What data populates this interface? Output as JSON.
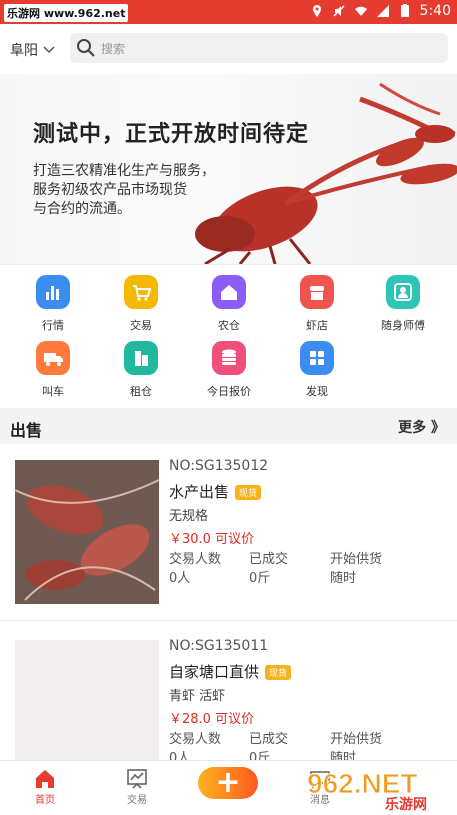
{
  "status": {
    "watermark": "乐游网 www.962.net",
    "time": "5:40"
  },
  "header": {
    "city": "阜阳",
    "search_placeholder": "搜索"
  },
  "banner": {
    "headline": "测试中，正式开放时间待定",
    "sub_lines": [
      "打造三农精准化生产与服务，",
      "服务初级农产品市场现货",
      "与合约的流通。"
    ]
  },
  "categories": [
    {
      "label": "行情",
      "color": "#3b8ef0",
      "icon": "chart-icon"
    },
    {
      "label": "交易",
      "color": "#f5b800",
      "icon": "cart-icon"
    },
    {
      "label": "农仓",
      "color": "#8b5cf6",
      "icon": "home-icon"
    },
    {
      "label": "虾店",
      "color": "#f0544f",
      "icon": "shop-icon"
    },
    {
      "label": "随身师傅",
      "color": "#2ec4b6",
      "icon": "person-icon"
    },
    {
      "label": "叫车",
      "color": "#ff7a3c",
      "icon": "truck-icon"
    },
    {
      "label": "租仓",
      "color": "#22b8a0",
      "icon": "warehouse-icon"
    },
    {
      "label": "今日报价",
      "color": "#f04f7a",
      "icon": "coins-icon"
    },
    {
      "label": "发现",
      "color": "#3b8ef0",
      "icon": "grid-icon"
    }
  ],
  "section": {
    "title": "出售",
    "more": "更多 》"
  },
  "items": [
    {
      "no": "NO:SG135012",
      "name": "水产出售",
      "badge": "现货",
      "spec": "无规格",
      "price": "￥30.0 可议价",
      "stats": [
        {
          "label": "交易人数",
          "value": "0人"
        },
        {
          "label": "已成交",
          "value": "0斤"
        },
        {
          "label": "开始供货",
          "value": "随时"
        }
      ]
    },
    {
      "no": "NO:SG135011",
      "name": "自家塘口直供",
      "badge": "现货",
      "spec": "青虾   活虾",
      "price": "￥28.0 可议价",
      "stats": [
        {
          "label": "交易人数",
          "value": "0人"
        },
        {
          "label": "已成交",
          "value": "0斤"
        },
        {
          "label": "开始供货",
          "value": "随时"
        }
      ]
    }
  ],
  "tabs": [
    {
      "label": "首页",
      "icon": "home-icon"
    },
    {
      "label": "交易",
      "icon": "trade-icon"
    },
    {
      "label": "消息",
      "icon": "message-icon"
    }
  ],
  "fab": "+",
  "watermark_962": "962.NET 乐游网",
  "colors": {
    "brand": "#e63b2f",
    "price": "#e02b22",
    "badge": "#f5b21b"
  }
}
